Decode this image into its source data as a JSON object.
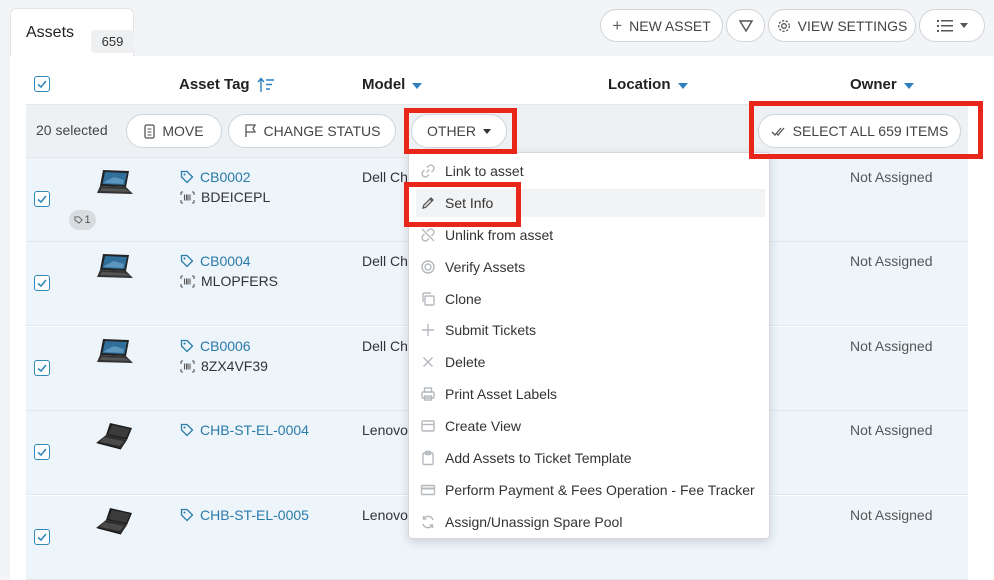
{
  "tab": {
    "label": "Assets",
    "count": "659"
  },
  "toolbar": {
    "new_asset": "NEW ASSET",
    "view_settings": "VIEW SETTINGS"
  },
  "columns": {
    "asset_tag": "Asset Tag",
    "model": "Model",
    "location": "Location",
    "owner": "Owner"
  },
  "bulk": {
    "selected": "20 selected",
    "move": "MOVE",
    "change_status": "CHANGE STATUS",
    "other": "OTHER",
    "select_all": "SELECT ALL 659 ITEMS"
  },
  "rows": [
    {
      "tag": "CB0002",
      "serial": "BDEICEPL",
      "model": "Dell Ch",
      "owner": "Not Assigned",
      "badge": "1"
    },
    {
      "tag": "CB0004",
      "serial": "MLOPFERS",
      "model": "Dell Ch",
      "owner": "Not Assigned"
    },
    {
      "tag": "CB0006",
      "serial": "8ZX4VF39",
      "model": "Dell Ch",
      "owner": "Not Assigned"
    },
    {
      "tag": "CHB-ST-EL-0004",
      "serial": "",
      "model": "Lenovo",
      "owner": "Not Assigned"
    },
    {
      "tag": "CHB-ST-EL-0005",
      "serial": "",
      "model": "Lenovo",
      "owner": "Not Assigned"
    }
  ],
  "menu": [
    {
      "label": "Link to asset",
      "icon": "link-icon"
    },
    {
      "label": "Set Info",
      "icon": "pencil-icon"
    },
    {
      "label": "Unlink from asset",
      "icon": "unlink-icon"
    },
    {
      "label": "Verify Assets",
      "icon": "verify-icon"
    },
    {
      "label": "Clone",
      "icon": "clone-icon"
    },
    {
      "label": "Submit Tickets",
      "icon": "plus-icon"
    },
    {
      "label": "Delete",
      "icon": "x-icon"
    },
    {
      "label": "Print Asset Labels",
      "icon": "printer-icon"
    },
    {
      "label": "Create View",
      "icon": "view-icon"
    },
    {
      "label": "Add Assets to Ticket Template",
      "icon": "clipboard-icon"
    },
    {
      "label": "Perform Payment & Fees Operation - Fee Tracker",
      "icon": "credit-card-icon"
    },
    {
      "label": "Assign/Unassign Spare Pool",
      "icon": "refresh-icon"
    }
  ],
  "colors": {
    "accent": "#2f7fbf",
    "highlight": "#e8271a",
    "row_bg": "#edf4fa"
  }
}
